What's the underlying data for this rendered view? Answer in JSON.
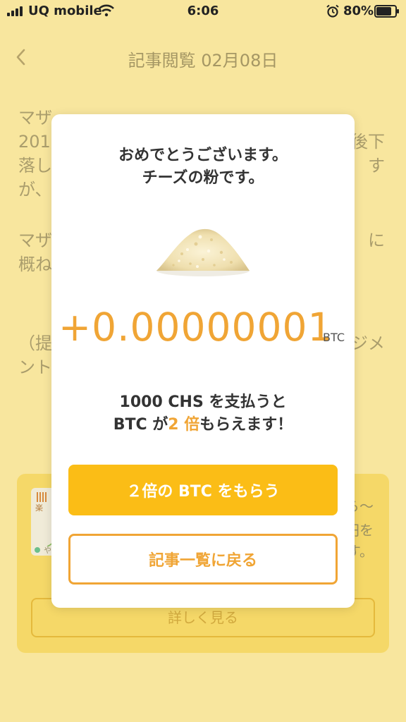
{
  "status_bar": {
    "carrier": "UQ mobile",
    "time": "6:06",
    "battery": "80%",
    "battery_level": 0.8
  },
  "nav": {
    "back_icon": "chevron-left-icon",
    "title": "記事閲覧 02月08日"
  },
  "article": {
    "p1_lines": [
      {
        "left": "マザ",
        "right": ""
      },
      {
        "left": "201",
        "right": "後下"
      },
      {
        "left": "落し",
        "right": "す"
      },
      {
        "left": "が、",
        "right": ""
      }
    ],
    "p2_lines": [
      {
        "left": "マザ",
        "right": "に"
      },
      {
        "left": "概ね",
        "right": ""
      }
    ],
    "p3_lines": [
      {
        "left": "（提",
        "right": "ジメ"
      },
      {
        "left": "ント",
        "right": ""
      }
    ]
  },
  "bg_card": {
    "side_lines": [
      "ら〜",
      "円を",
      "す。"
    ],
    "more_label": "詳しく見る"
  },
  "modal": {
    "message_line1": "おめでとうございます。",
    "message_line2": "チーズの粉です。",
    "image_name": "cheese-powder-image",
    "amount": "+0.00000001",
    "unit": "BTC",
    "promo_line1": "1000 CHS を支払うと",
    "promo_line2_pre": "BTC が",
    "promo_line2_hl": "2 倍",
    "promo_line2_post": "もらえます！",
    "primary_button": "２倍の BTC をもらう",
    "secondary_button": "記事一覧に戻る"
  },
  "colors": {
    "background": "#f8e69e",
    "accent": "#f0a535",
    "button_yellow": "#fbbd16"
  }
}
